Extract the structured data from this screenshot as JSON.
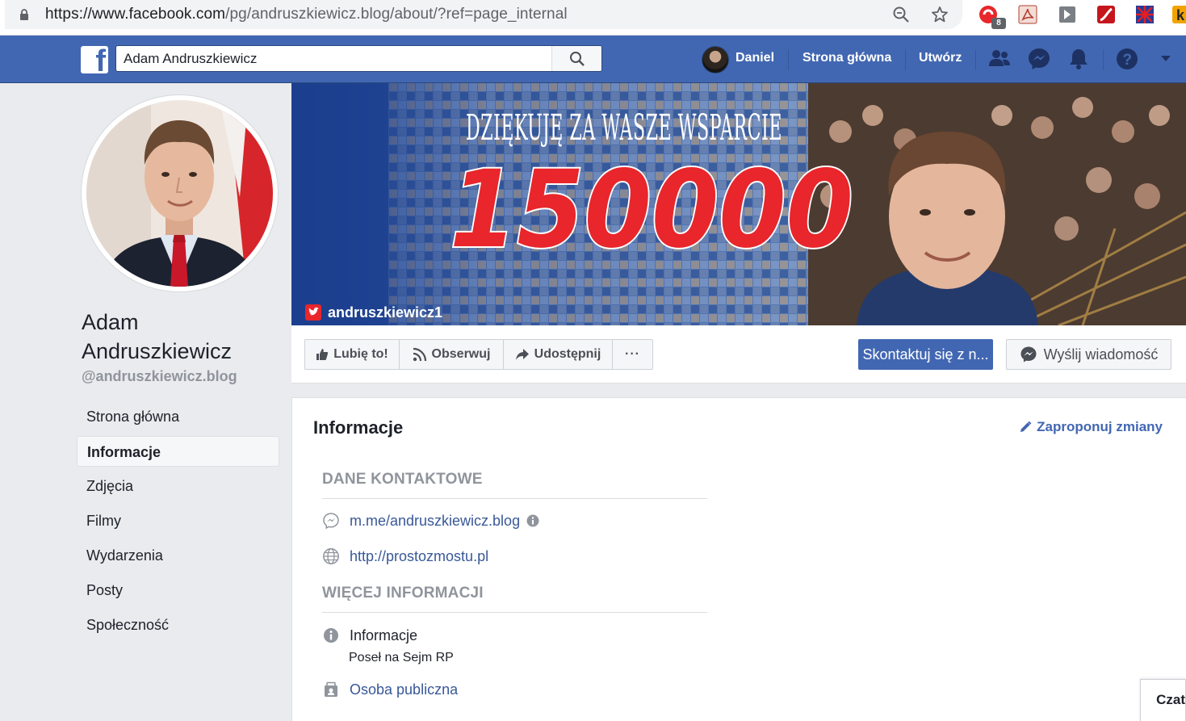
{
  "browser": {
    "url_prefix": "https://www.facebook.com",
    "url_rest": "/pg/andruszkiewicz.blog/about/?ref=page_internal",
    "extension_badge": "8"
  },
  "topbar": {
    "search_value": "Adam Andruszkiewicz",
    "user_name": "Daniel",
    "home_label": "Strona główna",
    "create_label": "Utwórz",
    "brand_color": "#4267b2"
  },
  "page": {
    "name": "Adam Andruszkiewicz",
    "handle": "@andruszkiewicz.blog"
  },
  "sidebar": {
    "items": [
      {
        "label": "Strona główna"
      },
      {
        "label": "Informacje"
      },
      {
        "label": "Zdjęcia"
      },
      {
        "label": "Filmy"
      },
      {
        "label": "Wydarzenia"
      },
      {
        "label": "Posty"
      },
      {
        "label": "Społeczność"
      }
    ],
    "active_index": 1
  },
  "cover": {
    "headline": "DZIĘKUJĘ ZA WASZE WSPARCIE",
    "number": "150000",
    "twitter_handle": "andruszkiewicz1"
  },
  "actions": {
    "like": "Lubię to!",
    "follow": "Obserwuj",
    "share": "Udostępnij",
    "more": "···",
    "contact": "Skontaktuj się z n...",
    "message": "Wyślij wiadomość"
  },
  "about": {
    "title": "Informacje",
    "suggest_edits": "Zaproponuj zmiany",
    "contact_heading": "DANE KONTAKTOWE",
    "messenger_link": "m.me/andruszkiewicz.blog",
    "website": "http://prostozmostu.pl",
    "more_heading": "WIĘCEJ INFORMACJI",
    "info_label": "Informacje",
    "info_value": "Poseł na Sejm RP",
    "category": "Osoba publiczna"
  },
  "chat": {
    "label": "Czat"
  }
}
